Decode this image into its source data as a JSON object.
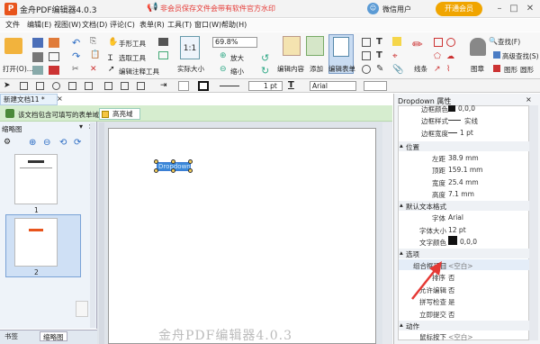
{
  "app": {
    "title": "金舟PDF编辑器4.0.3",
    "promo": "非会员保存文件会带有软件官方水印",
    "user": "微信用户",
    "vip_button": "开通会员"
  },
  "menu": [
    "文件",
    "编辑(E)",
    "视图(W)",
    "文档(D)",
    "评论(C)",
    "表单(R)",
    "工具(T)",
    "窗口(W)",
    "帮助(H)"
  ],
  "toolbar": {
    "open": "打开(O)...",
    "hand": "手形工具",
    "select_text": "选取工具",
    "edit_annot": "编辑注释工具",
    "actual_size": "实际大小",
    "zoom_value": "69.8%",
    "zoom_in": "放大",
    "zoom_out": "缩小",
    "edit_content": "编辑内容",
    "add": "添加",
    "edit_form": "编辑表单",
    "line": "线条",
    "stamp": "图章",
    "search": "查找(F)",
    "adv_search": "高级查找(S)",
    "shape": "图形",
    "circle": "圆形"
  },
  "format": {
    "line_width": "1 pt",
    "font": "Arial"
  },
  "document": {
    "tab": "新建文档11 *",
    "info": "该文档包含可填写的表单域。",
    "highlight_btn": "高亮域",
    "field_text": "Dropdown"
  },
  "thumbnails": {
    "title": "缩略图",
    "page1": "1",
    "page2": "2"
  },
  "bottom_tabs": [
    "书签",
    "缩略图"
  ],
  "watermark": "金舟PDF编辑器4.0.3",
  "properties": {
    "title": "Dropdown 属性",
    "border_color": {
      "label": "边框颜色",
      "value": "0,0,0"
    },
    "border_style": {
      "label": "边框样式",
      "value": "实线"
    },
    "border_width": {
      "label": "边框宽度",
      "value": "1 pt"
    },
    "position_section": "位置",
    "left": {
      "label": "左距",
      "value": "38.9 mm"
    },
    "top": {
      "label": "顶距",
      "value": "159.1 mm"
    },
    "width": {
      "label": "宽度",
      "value": "25.4 mm"
    },
    "height": {
      "label": "高度",
      "value": "7.1 mm"
    },
    "text_section": "默认文本格式",
    "font": {
      "label": "字体",
      "value": "Arial"
    },
    "font_size": {
      "label": "字体大小",
      "value": "12 pt"
    },
    "text_color": {
      "label": "文字颜色",
      "value": "0,0,0"
    },
    "options_section": "选项",
    "combo_items": {
      "label": "组合框项目",
      "value": "<空白>"
    },
    "sort": {
      "label": "排序",
      "value": "否"
    },
    "allow_edit": {
      "label": "允许编辑",
      "value": "否"
    },
    "spell_check": {
      "label": "拼写检查",
      "value": "是"
    },
    "commit": {
      "label": "立即提交",
      "value": "否"
    },
    "action_section": "动作",
    "mouse_down": {
      "label": "鼠标按下",
      "value": "<空白>"
    }
  },
  "colors": {
    "accent": "#e8541c",
    "form_field": "#3b88d8",
    "info_bg": "#d6edcf",
    "arrow": "#e53935"
  }
}
